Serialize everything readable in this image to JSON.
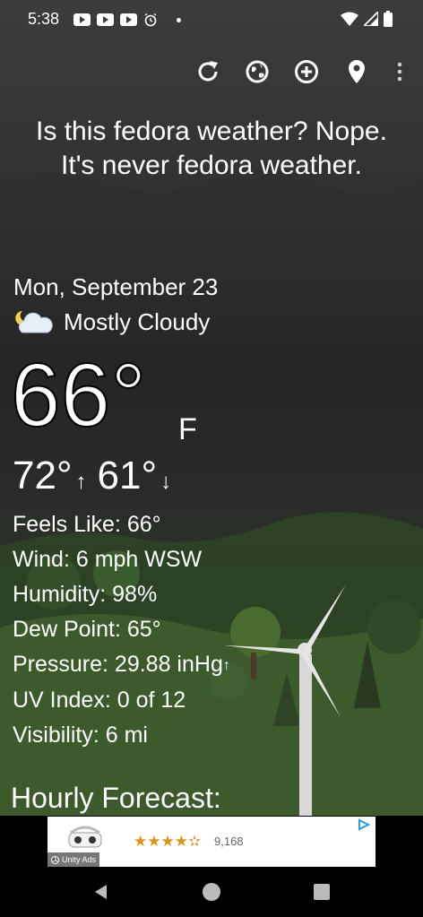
{
  "status_bar": {
    "time": "5:38",
    "left_icons": [
      "youtube-notification-icon",
      "youtube-notification-icon",
      "youtube-notification-icon",
      "alarm-icon",
      "dot-icon"
    ],
    "right_icons": [
      "wifi-icon",
      "signal-icon",
      "battery-icon"
    ]
  },
  "toolbar": {
    "actions": [
      "refresh-icon",
      "radar-globe-icon",
      "add-location-icon",
      "location-pin-icon",
      "overflow-menu-icon"
    ]
  },
  "headline": "Is this fedora weather? Nope. It's never fedora weather.",
  "current": {
    "date": "Mon, September 23",
    "condition_icon": "partly-cloudy-night-icon",
    "condition": "Mostly Cloudy",
    "temperature": "66°",
    "unit": "F",
    "high": "72°",
    "high_arrow": "↑",
    "low": "61°",
    "low_arrow": "↓"
  },
  "details": {
    "feels_like": "Feels Like:  66°",
    "wind": "Wind:  6 mph WSW",
    "humidity": "Humidity:  98%",
    "dew_point": "Dew Point:  65°",
    "pressure": "Pressure:  29.88 inHg",
    "pressure_trend": "↑",
    "uv_index": "UV Index:  0 of 12",
    "visibility": "Visibility:  6 mi"
  },
  "hourly_title": "Hourly Forecast:",
  "ad": {
    "stars": "★★★★✫",
    "rating_count": "9,168",
    "network": "Unity Ads"
  },
  "nav_bar": {
    "buttons": [
      "back-icon",
      "home-icon",
      "recents-icon"
    ]
  },
  "colors": {
    "text": "#ffffff",
    "star": "#d9941e",
    "background_top": "#3c3c3c",
    "grass": "#3e5a2f"
  }
}
